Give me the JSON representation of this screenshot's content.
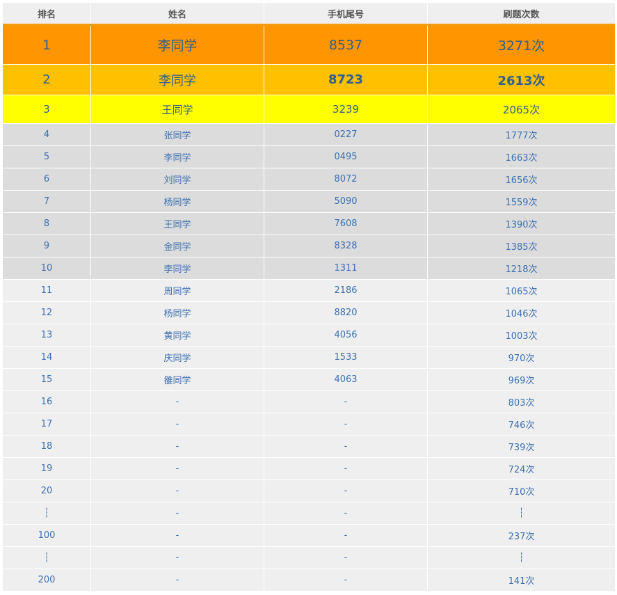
{
  "columns": [
    "排名",
    "姓名",
    "手机尾号",
    "刷题次数"
  ],
  "top_rows": [
    {
      "rank": "1",
      "name": "李同学",
      "phone": "8537",
      "count": "3271次"
    },
    {
      "rank": "2",
      "name": "李同学",
      "phone": "8723",
      "count": "2613次"
    },
    {
      "rank": "3",
      "name": "王同学",
      "phone": "3239",
      "count": "2065次"
    }
  ],
  "grey_rows": [
    {
      "rank": "4",
      "name": "张同学",
      "phone": "0227",
      "count": "1777次"
    },
    {
      "rank": "5",
      "name": "李同学",
      "phone": "0495",
      "count": "1663次"
    },
    {
      "rank": "6",
      "name": "刘同学",
      "phone": "8072",
      "count": "1656次"
    },
    {
      "rank": "7",
      "name": "杨同学",
      "phone": "5090",
      "count": "1559次"
    },
    {
      "rank": "8",
      "name": "王同学",
      "phone": "7608",
      "count": "1390次"
    },
    {
      "rank": "9",
      "name": "金同学",
      "phone": "8328",
      "count": "1385次"
    },
    {
      "rank": "10",
      "name": "李同学",
      "phone": "1311",
      "count": "1218次"
    }
  ],
  "light_rows": [
    {
      "rank": "11",
      "name": "周同学",
      "phone": "2186",
      "count": "1065次"
    },
    {
      "rank": "12",
      "name": "杨同学",
      "phone": "8820",
      "count": "1046次"
    },
    {
      "rank": "13",
      "name": "黄同学",
      "phone": "4056",
      "count": "1003次"
    },
    {
      "rank": "14",
      "name": "庆同学",
      "phone": "1533",
      "count": "970次"
    },
    {
      "rank": "15",
      "name": "雒同学",
      "phone": "4063",
      "count": "969次"
    },
    {
      "rank": "16",
      "name": "-",
      "phone": "-",
      "count": "803次"
    },
    {
      "rank": "17",
      "name": "-",
      "phone": "-",
      "count": "746次"
    },
    {
      "rank": "18",
      "name": "-",
      "phone": "-",
      "count": "739次"
    },
    {
      "rank": "19",
      "name": "-",
      "phone": "-",
      "count": "724次"
    },
    {
      "rank": "20",
      "name": "-",
      "phone": "-",
      "count": "710次"
    },
    {
      "rank": "┆",
      "name": "-",
      "phone": "-",
      "count": "┆"
    },
    {
      "rank": "100",
      "name": "-",
      "phone": "-",
      "count": "237次"
    },
    {
      "rank": "┆",
      "name": "-",
      "phone": "-",
      "count": "┆"
    },
    {
      "rank": "200",
      "name": "-",
      "phone": "-",
      "count": "141次"
    }
  ],
  "colors": {
    "header_bg": "#efefef",
    "header_border": "#f39c12",
    "rank1_bg": "#ff9500",
    "rank2_bg": "#ffc000",
    "rank3_bg": "#ffff00",
    "grey_bg": "#dcdcdc",
    "light_bg": "#efefef",
    "text_blue": "#3d6fb0"
  }
}
